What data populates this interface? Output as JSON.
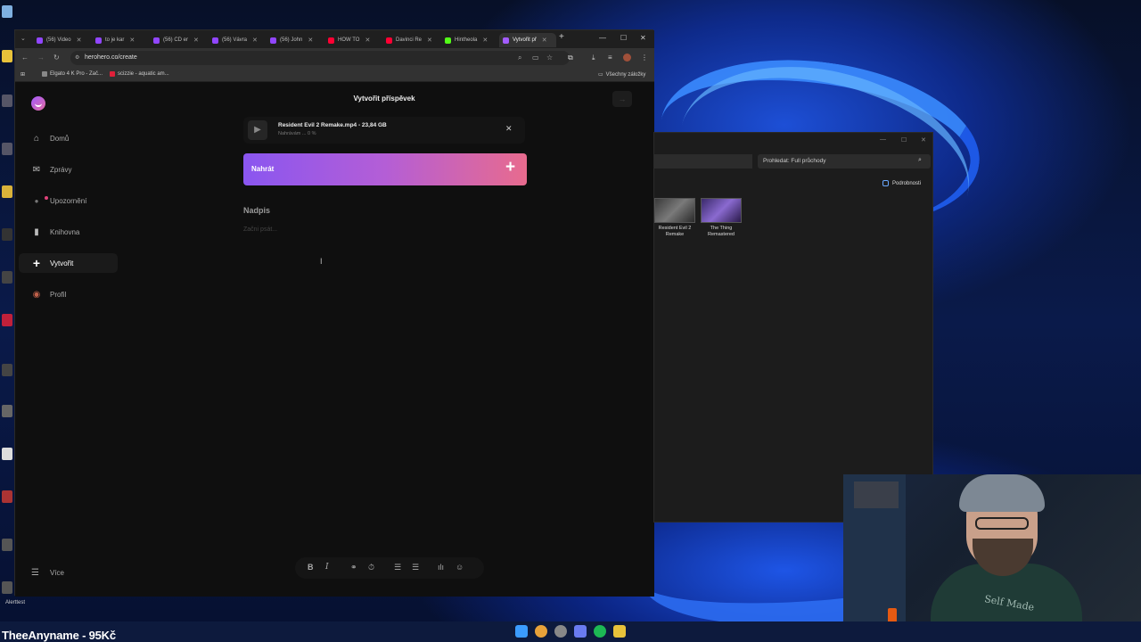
{
  "browser": {
    "tabs": [
      {
        "label": "(56) Video",
        "color": "#9146ff"
      },
      {
        "label": "to je kar",
        "color": "#9146ff"
      },
      {
        "label": "(56) CD er",
        "color": "#9146ff"
      },
      {
        "label": "(56) Vávra",
        "color": "#9146ff"
      },
      {
        "label": "(56) John",
        "color": "#9146ff"
      },
      {
        "label": "HOW TO",
        "color": "#ff0033"
      },
      {
        "label": "Davinci Re",
        "color": "#ff0033"
      },
      {
        "label": "Hintheola",
        "color": "#53fc18"
      },
      {
        "label": "Vytvořit př",
        "color": "#a35cff"
      }
    ],
    "url": "herohero.co/create",
    "bookmarks": [
      {
        "label": "Elgato 4 K Pro - Zač...",
        "color": "#888888"
      },
      {
        "label": "scizzie - aquatic am...",
        "color": "#e0203a"
      }
    ],
    "all_bookmarks": "Všechny záložky"
  },
  "app": {
    "sidebar": [
      {
        "label": "Domů",
        "icon": "home-icon",
        "glyph": "⌂"
      },
      {
        "label": "Zprávy",
        "icon": "message-icon",
        "glyph": "✉"
      },
      {
        "label": "Upozornění",
        "icon": "bell-icon",
        "glyph": "●"
      },
      {
        "label": "Knihovna",
        "icon": "bookmark-icon",
        "glyph": "▮"
      },
      {
        "label": "Vytvořit",
        "icon": "plus-icon",
        "glyph": "+"
      },
      {
        "label": "Profil",
        "icon": "avatar-icon",
        "glyph": "◉"
      }
    ],
    "more_label": "Více",
    "page_title": "Vytvořit příspěvek",
    "upload": {
      "file_name": "Resident Evil 2 Remake.mp4 - 23,84 GB",
      "status": "Nahrávám ... 0 %",
      "button_label": "Nahrát"
    },
    "heading_placeholder": "Nadpis",
    "body_placeholder": "Začni psát..."
  },
  "explorer": {
    "search_placeholder": "Prohledat: Full průchody",
    "details_label": "Podrobnosti",
    "files": [
      {
        "line1": "Resident Evil 2",
        "line2": "Remake"
      },
      {
        "line1": "The Thing",
        "line2": "Remastered"
      }
    ]
  },
  "overlay": {
    "stream_text": "TheeAnyname - 95Kč",
    "desktop_label": "Alerttest",
    "shirt_text": "Self Made"
  }
}
